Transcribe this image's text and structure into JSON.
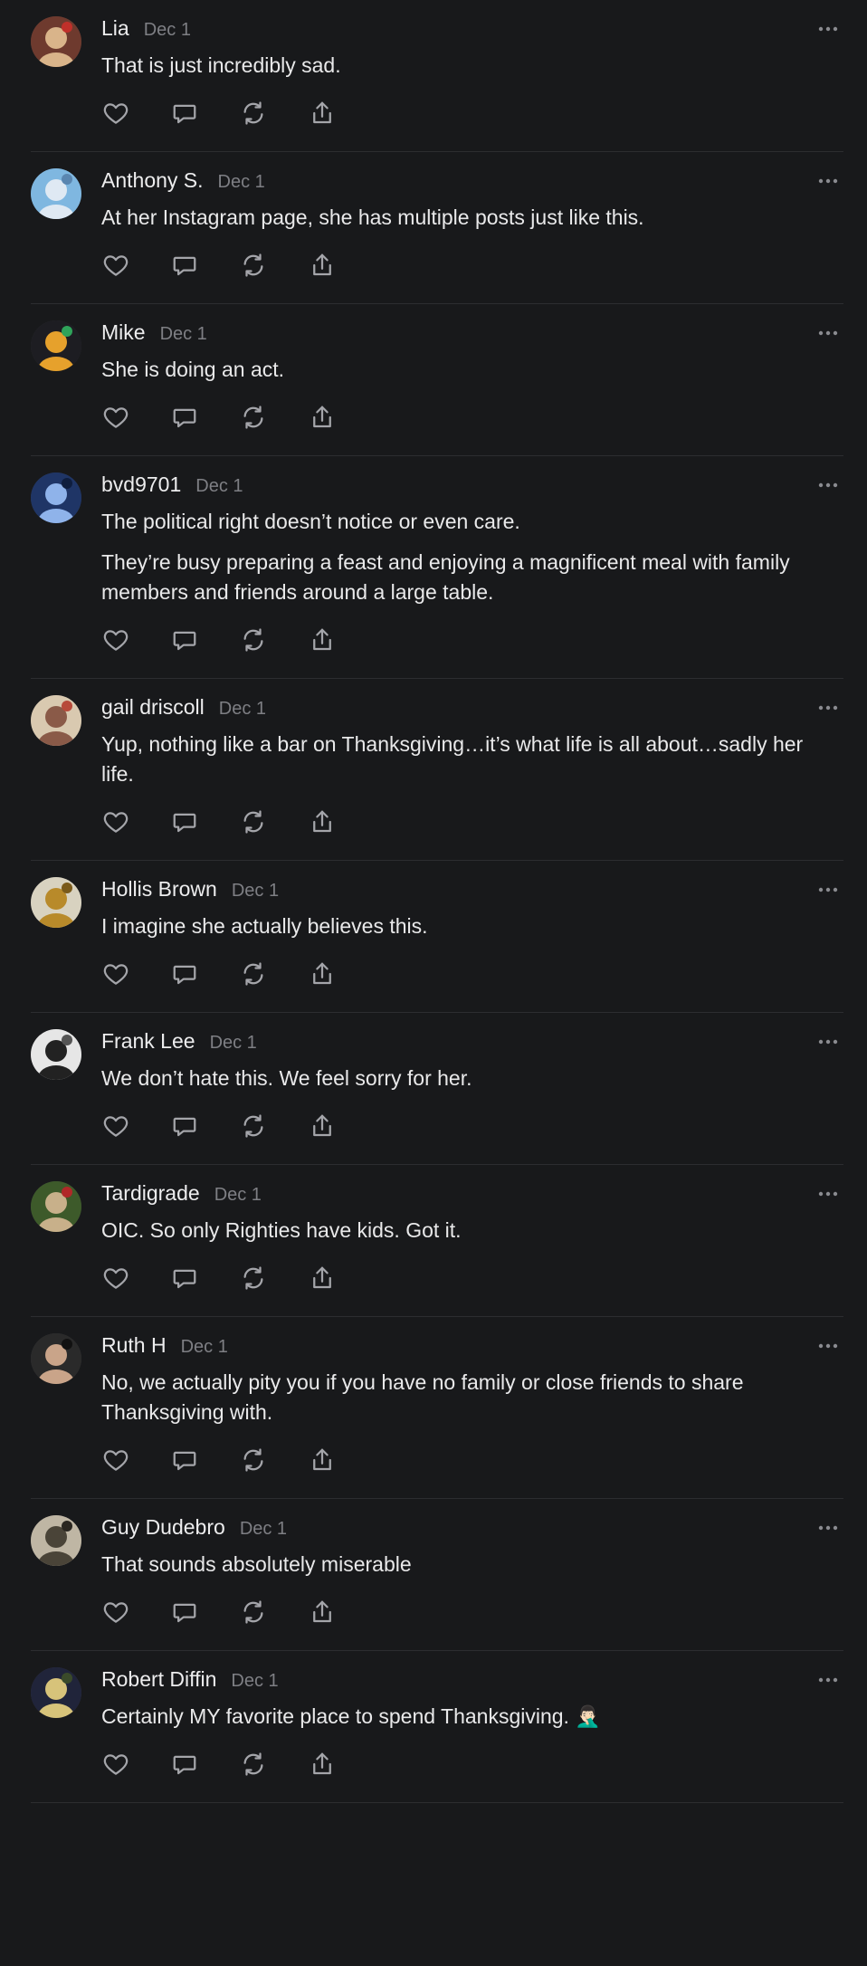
{
  "icons": {
    "like": "heart-icon",
    "reply": "comment-bubble-icon",
    "restack": "repost-icon",
    "share": "share-icon",
    "more": "ellipsis-icon"
  },
  "colors": {
    "background": "#18191b",
    "text": "#e9e9ea",
    "muted": "#7e7f84",
    "icon": "#a4a5aa",
    "divider": "#2c2d30"
  },
  "comments": [
    {
      "name": "Lia",
      "date": "Dec 1",
      "paragraphs": [
        "That is just incredibly sad."
      ],
      "avatar": {
        "bg": "#6e3a2e",
        "fg": "#d9b48a",
        "accent": "#c0302a"
      }
    },
    {
      "name": "Anthony S.",
      "date": "Dec 1",
      "paragraphs": [
        "At her Instagram page, she has multiple posts just like this."
      ],
      "avatar": {
        "bg": "#7fb7e0",
        "fg": "#dfe9f3",
        "accent": "#5a86b0"
      }
    },
    {
      "name": "Mike",
      "date": "Dec 1",
      "paragraphs": [
        "She is doing an act."
      ],
      "avatar": {
        "bg": "#1d1d22",
        "fg": "#e6a12c",
        "accent": "#2fa35a"
      }
    },
    {
      "name": "bvd9701",
      "date": "Dec 1",
      "paragraphs": [
        "The political right doesn’t notice or even care.",
        "They’re busy preparing a feast and enjoying a magnificent meal with family members and friends around a large table."
      ],
      "avatar": {
        "bg": "#1f3566",
        "fg": "#8fb3ea",
        "accent": "#0f1e3e"
      }
    },
    {
      "name": "gail driscoll",
      "date": "Dec 1",
      "paragraphs": [
        "Yup, nothing like a bar on Thanksgiving…it’s what life is all about…sadly her life."
      ],
      "avatar": {
        "bg": "#d9c9b0",
        "fg": "#8a5a48",
        "accent": "#b74a3a"
      }
    },
    {
      "name": "Hollis Brown",
      "date": "Dec 1",
      "paragraphs": [
        "I imagine she actually believes this."
      ],
      "avatar": {
        "bg": "#d8d2c0",
        "fg": "#b88a2a",
        "accent": "#7a5a1a"
      }
    },
    {
      "name": "Frank Lee",
      "date": "Dec 1",
      "paragraphs": [
        "We don’t hate this. We feel sorry for her."
      ],
      "avatar": {
        "bg": "#e6e6e6",
        "fg": "#222222",
        "accent": "#555555"
      }
    },
    {
      "name": "Tardigrade",
      "date": "Dec 1",
      "paragraphs": [
        "OIC. So only Righties have kids. Got it."
      ],
      "avatar": {
        "bg": "#3d5a2a",
        "fg": "#c8b08a",
        "accent": "#b02828"
      }
    },
    {
      "name": "Ruth H",
      "date": "Dec 1",
      "paragraphs": [
        "No, we actually pity you if you have no family or close friends to share Thanksgiving with."
      ],
      "avatar": {
        "bg": "#2a2a2a",
        "fg": "#c9a489",
        "accent": "#111111"
      }
    },
    {
      "name": "Guy Dudebro",
      "date": "Dec 1",
      "paragraphs": [
        "That sounds absolutely miserable"
      ],
      "avatar": {
        "bg": "#bfb6a4",
        "fg": "#4a4438",
        "accent": "#2a2620"
      }
    },
    {
      "name": "Robert Diffin",
      "date": "Dec 1",
      "paragraphs": [
        "Certainly MY favorite place to spend Thanksgiving. 🤦🏻‍♂️"
      ],
      "avatar": {
        "bg": "#20243a",
        "fg": "#d7c37a",
        "accent": "#3a4a2a"
      }
    }
  ]
}
